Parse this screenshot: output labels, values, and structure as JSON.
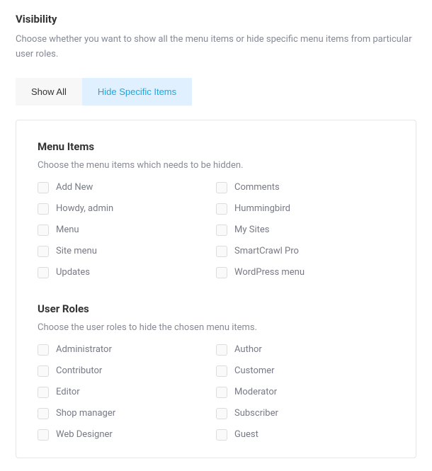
{
  "header": {
    "title": "Visibility",
    "description": "Choose whether you want to show all the menu items or hide specific menu items from particular user roles."
  },
  "tabs": {
    "show_all": "Show All",
    "hide_specific": "Hide Specific Items"
  },
  "menu_items": {
    "title": "Menu Items",
    "description": "Choose the menu items which needs to be hidden.",
    "items": [
      "Add New",
      "Comments",
      "Howdy, admin",
      "Hummingbird",
      "Menu",
      "My Sites",
      "Site menu",
      "SmartCrawl Pro",
      "Updates",
      "WordPress menu"
    ]
  },
  "user_roles": {
    "title": "User Roles",
    "description": "Choose the user roles to hide the chosen menu items.",
    "items": [
      "Administrator",
      "Author",
      "Contributor",
      "Customer",
      "Editor",
      "Moderator",
      "Shop manager",
      "Subscriber",
      "Web Designer",
      "Guest"
    ]
  }
}
